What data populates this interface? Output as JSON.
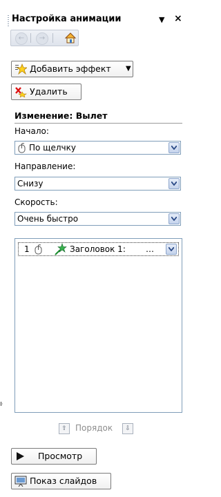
{
  "pane": {
    "title": "Настройка анимации",
    "dropdown_icon": "▼",
    "close_icon": "×"
  },
  "navbar": {
    "back": "←",
    "forward": "→"
  },
  "toolbar": {
    "add_effect_label": "Добавить эффект",
    "remove_label": "Удалить"
  },
  "change": {
    "section_title": "Изменение: Вылет",
    "start_label": "Начало:",
    "start_value": "По щелчку",
    "direction_label": "Направление:",
    "direction_value": "Снизу",
    "speed_label": "Скорость:",
    "speed_value": "Очень быстро"
  },
  "effects_list": [
    {
      "order": "1",
      "label": "Заголовок 1:",
      "ellipsis": "…"
    }
  ],
  "reorder": {
    "label": "Порядок",
    "up": "⇧",
    "down": "⇩"
  },
  "bottom": {
    "preview_label": "Просмотр",
    "slideshow_label": "Показ слайдов"
  },
  "stray_text": "ıc"
}
